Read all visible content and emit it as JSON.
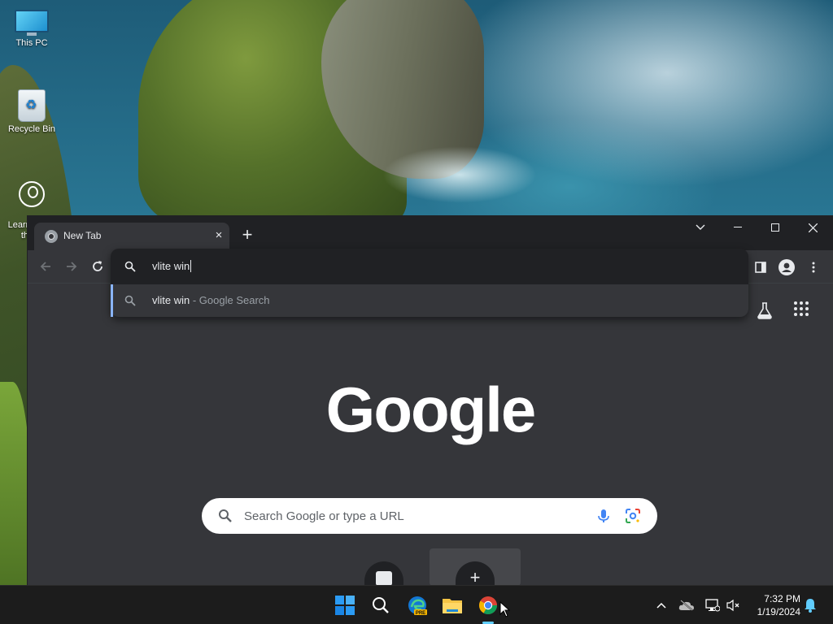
{
  "desktop": {
    "icons": [
      {
        "label": "This PC"
      },
      {
        "label": "Recycle Bin"
      },
      {
        "label": "Learn about this picture",
        "label_visible": "Learn about\nthis p"
      }
    ]
  },
  "browser": {
    "tab": {
      "title": "New Tab",
      "close_glyph": "×"
    },
    "new_tab_glyph": "+",
    "omnibox": {
      "input_value": "vlite win",
      "suggestion_query": "vlite win",
      "suggestion_suffix": " - Google Search"
    },
    "ntp": {
      "logo": "Google",
      "search_placeholder": "Search Google or type a URL",
      "add_shortcut_glyph": "+"
    }
  },
  "taskbar": {
    "clock_time": "7:32 PM",
    "clock_date": "1/19/2024",
    "edge_badge": "PRE"
  },
  "colors": {
    "accent": "#8ab4f8",
    "taskbar_active": "#60cdff",
    "chrome_dark": "#202124",
    "chrome_surface": "#35363a"
  }
}
